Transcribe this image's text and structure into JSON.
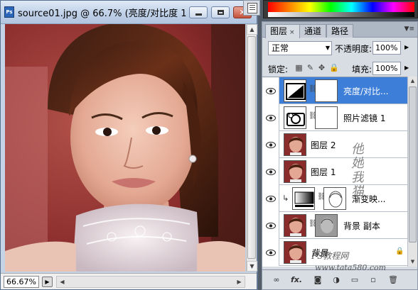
{
  "document": {
    "title": "source01.jpg @ 66.7% (亮度/对比度 1,...",
    "zoom": "66.67%",
    "app_icon": "Ps"
  },
  "panel": {
    "tabs": [
      {
        "label": "图层",
        "close": "×"
      },
      {
        "label": "通道"
      },
      {
        "label": "路径"
      }
    ],
    "blend_mode": "正常",
    "opacity_label": "不透明度:",
    "opacity_value": "100%",
    "lock_label": "锁定:",
    "fill_label": "填充:",
    "fill_value": "100%"
  },
  "layers": [
    {
      "name": "亮度/对比...",
      "selected": true,
      "type": "adjustment-brightness"
    },
    {
      "name": "照片滤镜 1",
      "selected": false,
      "type": "adjustment-photofilter"
    },
    {
      "name": "图层 2",
      "selected": false,
      "type": "image"
    },
    {
      "name": "图层 1",
      "selected": false,
      "type": "image"
    },
    {
      "name": "渐变映...",
      "selected": false,
      "type": "adjustment-gradientmap",
      "clipped": true
    },
    {
      "name": "背景 副本",
      "selected": false,
      "type": "image-sketch"
    },
    {
      "name": "背景",
      "selected": false,
      "type": "background",
      "locked": true
    }
  ],
  "watermark": {
    "signature": "他她我猫",
    "site": "PS教程网",
    "url": "www.tata580.com"
  },
  "colors": {
    "selection": "#3d7ed8",
    "panel_bg": "#d8dde4",
    "title_gradient_top": "#dfe9f6"
  }
}
